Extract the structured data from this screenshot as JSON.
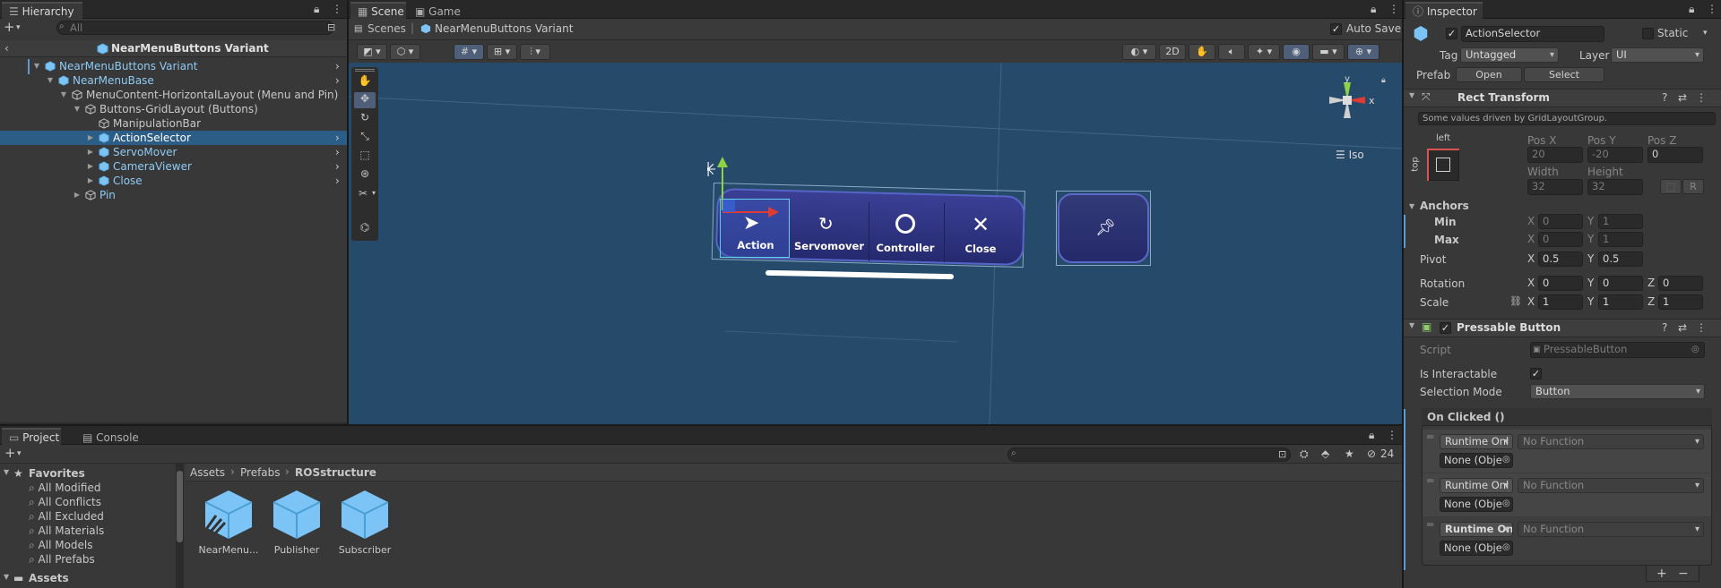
{
  "hierarchy": {
    "tab": "Hierarchy",
    "search_placeholder": "All",
    "header": "NearMenuButtons Variant",
    "items": [
      {
        "label": "NearMenuButtons Variant"
      },
      {
        "label": "NearMenuBase"
      },
      {
        "label": "MenuContent-HorizontalLayout (Menu and Pin)"
      },
      {
        "label": "Buttons-GridLayout (Buttons)"
      },
      {
        "label": "ManipulationBar"
      },
      {
        "label": "ActionSelector"
      },
      {
        "label": "ServoMover"
      },
      {
        "label": "CameraViewer"
      },
      {
        "label": "Close"
      },
      {
        "label": "Pin"
      }
    ]
  },
  "scene": {
    "tabs": [
      "Scene",
      "Game"
    ],
    "breadcrumb_root": "Scenes",
    "breadcrumb_current": "NearMenuButtons Variant",
    "auto_save": "Auto Save",
    "btn_2d": "2D",
    "iso_label": "Iso",
    "gizmo_y": "y",
    "gizmo_x": "x",
    "buttons": [
      {
        "label": "Action"
      },
      {
        "label": "Servomover"
      },
      {
        "label": "Controller"
      },
      {
        "label": "Close"
      }
    ]
  },
  "project": {
    "tabs": [
      "Project",
      "Console"
    ],
    "hidden_count": "24",
    "favorites_label": "Favorites",
    "favorites": [
      "All Modified",
      "All Conflicts",
      "All Excluded",
      "All Materials",
      "All Models",
      "All Prefabs"
    ],
    "assets_label": "Assets",
    "breadcrumb": [
      "Assets",
      "Prefabs",
      "ROSstructure"
    ],
    "assets": [
      {
        "name": "NearMenu..."
      },
      {
        "name": "Publisher"
      },
      {
        "name": "Subscriber"
      }
    ]
  },
  "inspector": {
    "tab": "Inspector",
    "object_name": "ActionSelector",
    "static_label": "Static",
    "tag_label": "Tag",
    "tag_value": "Untagged",
    "layer_label": "Layer",
    "layer_value": "UI",
    "prefab_label": "Prefab",
    "open_btn": "Open",
    "select_btn": "Select",
    "rect_transform": {
      "title": "Rect Transform",
      "note": "Some values driven by GridLayoutGroup.",
      "anchor_h": "left",
      "anchor_v": "top",
      "posx_label": "Pos X",
      "posy_label": "Pos Y",
      "posz_label": "Pos Z",
      "posx": "20",
      "posy": "-20",
      "posz": "0",
      "width_label": "Width",
      "height_label": "Height",
      "width": "32",
      "height": "32",
      "r_btn": "R",
      "anchors_label": "Anchors",
      "min_label": "Min",
      "max_label": "Max",
      "min_x": "0",
      "min_y": "1",
      "max_x": "0",
      "max_y": "1",
      "pivot_label": "Pivot",
      "pivot_x": "0.5",
      "pivot_y": "0.5",
      "rotation_label": "Rotation",
      "rot_x": "0",
      "rot_y": "0",
      "rot_z": "0",
      "scale_label": "Scale",
      "scale_x": "1",
      "scale_y": "1",
      "scale_z": "1",
      "x": "X",
      "y": "Y",
      "z": "Z"
    },
    "pressable": {
      "title": "Pressable Button",
      "script_label": "Script",
      "script_value": "PressableButton",
      "interactable_label": "Is Interactable",
      "selection_label": "Selection Mode",
      "selection_value": "Button",
      "on_clicked": "On Clicked ()",
      "events": [
        {
          "runtime": "Runtime Onl",
          "func": "No Function",
          "obj": "None (Obje"
        },
        {
          "runtime": "Runtime Onl",
          "func": "No Function",
          "obj": "None (Obje"
        },
        {
          "runtime": "Runtime On",
          "func": "No Function",
          "obj": "None (Obje"
        }
      ],
      "add": "+",
      "remove": "−"
    }
  },
  "colors": {
    "selection": "#2c5d87",
    "scene_bg": "#264a6a",
    "prefab_blue": "#7cc4f5",
    "button_fill": "#2a2f70"
  }
}
